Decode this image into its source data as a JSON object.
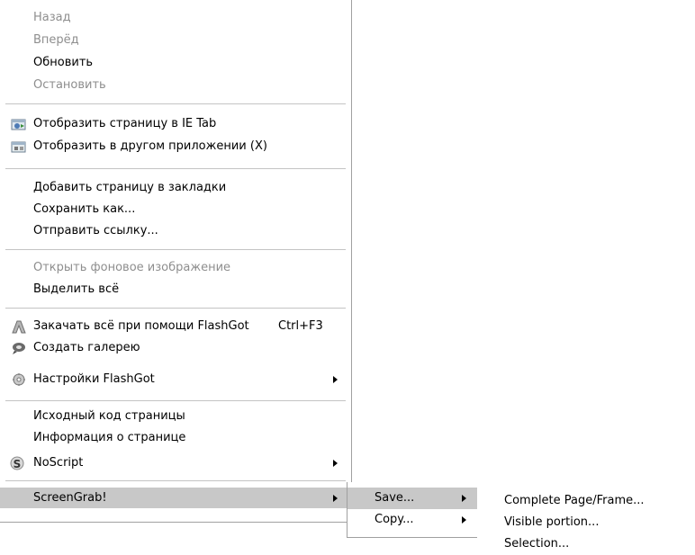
{
  "main_menu": {
    "back": "Назад",
    "forward": "Вперёд",
    "reload": "Обновить",
    "stop": "Остановить",
    "ie_tab": "Отобразить страницу в IE Tab",
    "external_app": "Отобразить в другом приложении (X)",
    "bookmark": "Добавить страницу в закладки",
    "save_as": "Сохранить как...",
    "send_link": "Отправить ссылку...",
    "view_bg_image": "Открыть фоновое изображение",
    "select_all": "Выделить всё",
    "flashgot_all": "Закачать всё при помощи FlashGot",
    "flashgot_shortcut": "Ctrl+F3",
    "create_gallery": "Создать галерею",
    "flashgot_settings": "Настройки FlashGot",
    "view_source": "Исходный код страницы",
    "page_info": "Информация о странице",
    "noscript": "NoScript",
    "screengrab": "ScreenGrab!"
  },
  "screengrab_submenu": {
    "save": "Save...",
    "copy": "Copy..."
  },
  "save_submenu": {
    "complete_page": "Complete Page/Frame...",
    "visible_portion": "Visible portion...",
    "selection": "Selection..."
  },
  "colors": {
    "disabled_text": "#8e8e8e",
    "highlight": "#c8c8c8",
    "separator": "#c4c4c4"
  },
  "icons": [
    "ie-tab-icon",
    "external-app-icon",
    "flashgot-icon",
    "gallery-icon",
    "flashgot-settings-icon",
    "noscript-icon"
  ]
}
